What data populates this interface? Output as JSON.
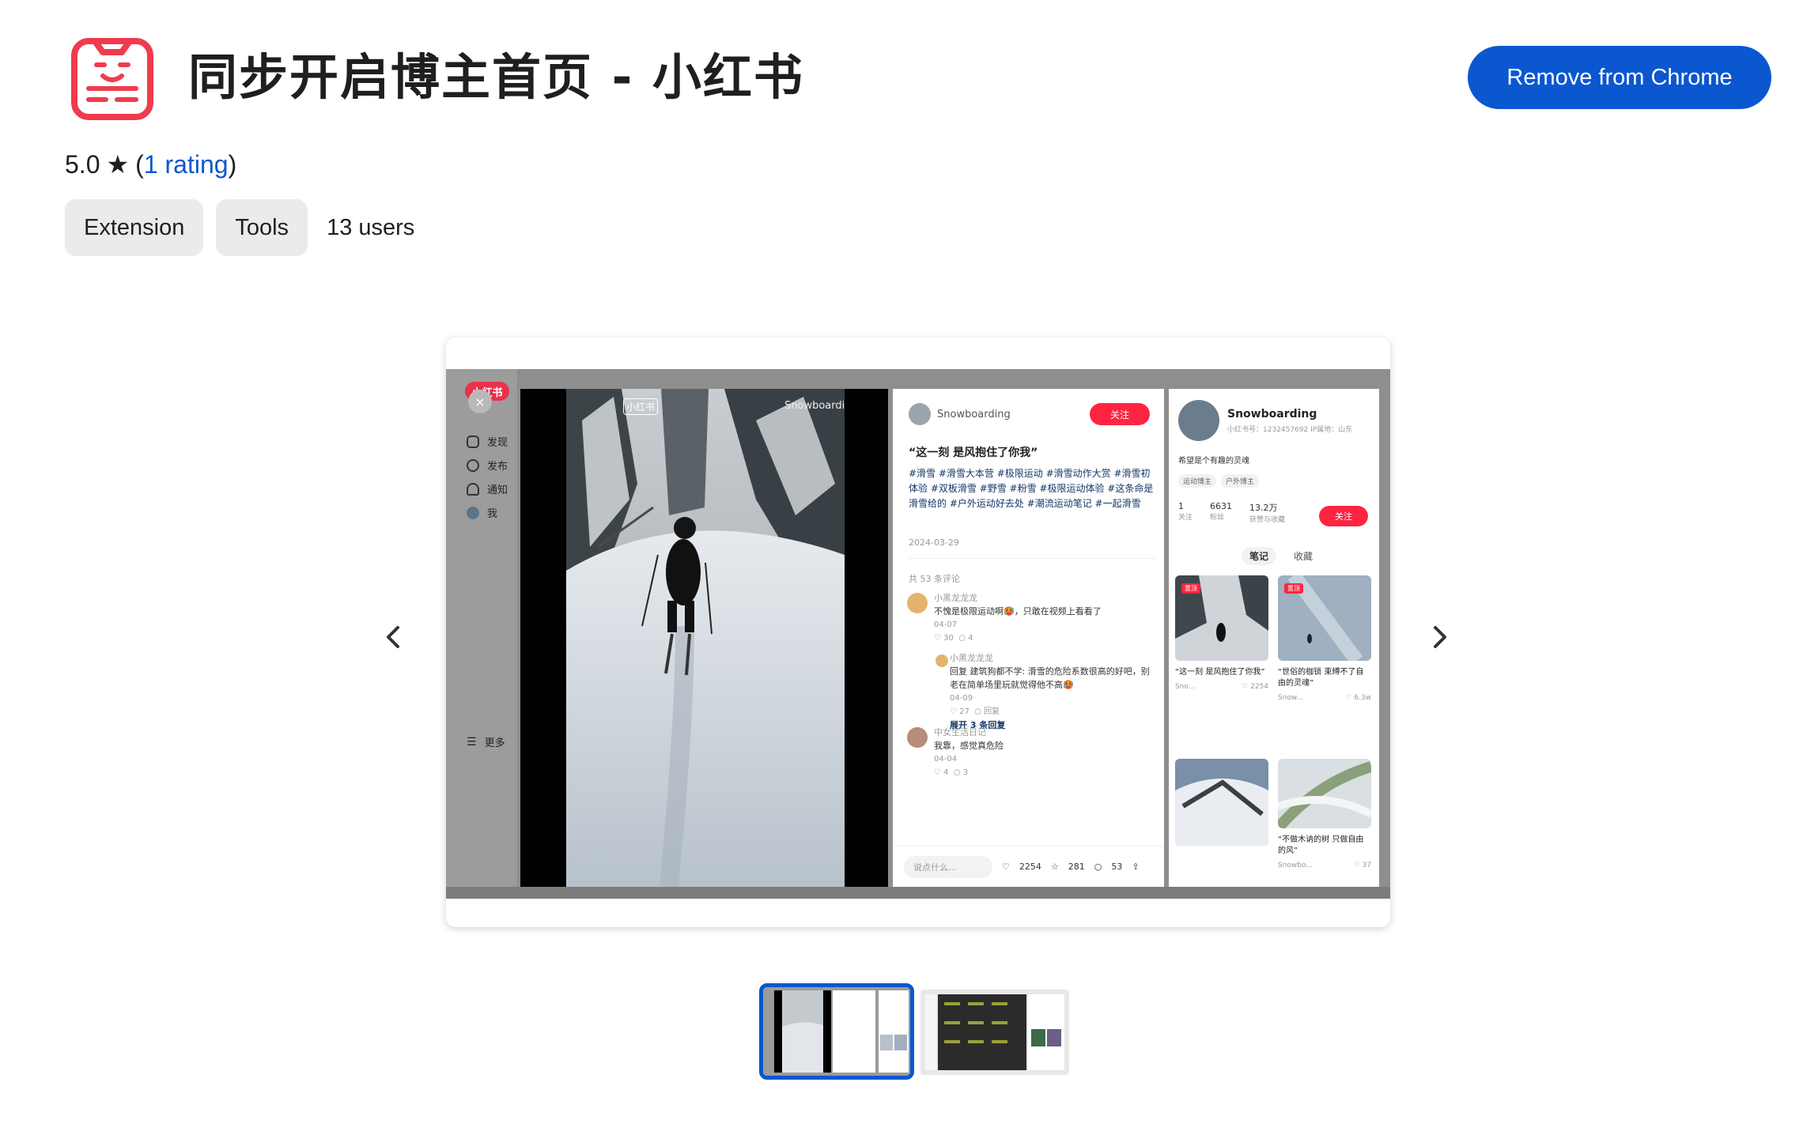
{
  "header": {
    "title": "同步开启博主首页 - 小红书",
    "icon": "xiaohongshu-face-icon",
    "remove_button": "Remove from Chrome"
  },
  "rating": {
    "score": "5.0",
    "star": "★",
    "open_paren": "(",
    "count_label": "1 rating",
    "close_paren": ")"
  },
  "chips": [
    "Extension",
    "Tools"
  ],
  "users": "13 users",
  "colors": {
    "accent": "#0b57d0",
    "brand_red": "#ff2442",
    "icon_red": "#ee3c4e"
  },
  "screenshot": {
    "sidebar": {
      "logo": "小红书",
      "close": "×",
      "items": [
        "发现",
        "发布",
        "通知",
        "我"
      ],
      "more": "更多"
    },
    "video": {
      "label": "小红书",
      "watermark": "Snowboarding"
    },
    "post": {
      "author": "Snowboarding",
      "follow": "关注",
      "title": "“这一刻 是风抱住了你我”",
      "tags": "#滑雪 #滑雪大本营 #极限运动 #滑雪动作大赏 #滑雪初体验 #双板滑雪 #野雪 #粉雪 #极限运动体验 #这条命是滑雪给的 #户外运动好去处 #潮流运动笔记 #一起滑雪",
      "date": "2024-03-29",
      "comment_count": "共 53 条评论",
      "comments": [
        {
          "name": "小黑龙龙龙",
          "text": "不愧是极限运动啊🥵，只敢在视频上看看了",
          "date": "04-07",
          "likes": "30",
          "replies": "4"
        },
        {
          "name": "小黑龙龙龙",
          "text": "回复 建筑狗都不学: 滑雪的危险系数很高的好吧，别老在简单场里玩就觉得他不高🥵",
          "date": "04-09",
          "likes": "27",
          "replies": "回复"
        },
        {
          "name": "中女生活日记",
          "text": "我靠，感觉真危险",
          "date": "04-04",
          "likes": "4",
          "replies": "3"
        }
      ],
      "more_replies": "展开 3 条回复",
      "input_placeholder": "说点什么...",
      "stats": {
        "likes": "2254",
        "collects": "281",
        "comments": "53"
      }
    },
    "profile": {
      "name": "Snowboarding",
      "id": "小红书号：1232457692  IP属地：山东",
      "bio": "希望是个有趣的灵魂",
      "tags": [
        "运动博主",
        "户外博主"
      ],
      "stats": [
        {
          "value": "1",
          "label": "关注"
        },
        {
          "value": "6631",
          "label": "粉丝"
        },
        {
          "value": "13.2万",
          "label": "获赞与收藏"
        }
      ],
      "follow": "关注",
      "tabs": [
        "笔记",
        "收藏"
      ],
      "cards": [
        {
          "badge": "置顶",
          "caption": "“这一刻 是风抱住了你我”",
          "author": "Sno...",
          "likes": "2254"
        },
        {
          "badge": "置顶",
          "caption": "“世俗的枷锁 束缚不了自由的灵魂”",
          "author": "Snow...",
          "likes": "6.3w"
        },
        {
          "badge": "",
          "caption": "",
          "author": "",
          "likes": ""
        },
        {
          "badge": "",
          "caption": "“不做木讷的树 只做自由的风”",
          "author": "Snowbo...",
          "likes": "37"
        }
      ]
    }
  },
  "carousel": {
    "prev_icon": "chevron-left-icon",
    "next_icon": "chevron-right-icon",
    "thumbnails": [
      "thumbnail-1",
      "thumbnail-2"
    ],
    "selected_index": 0
  }
}
